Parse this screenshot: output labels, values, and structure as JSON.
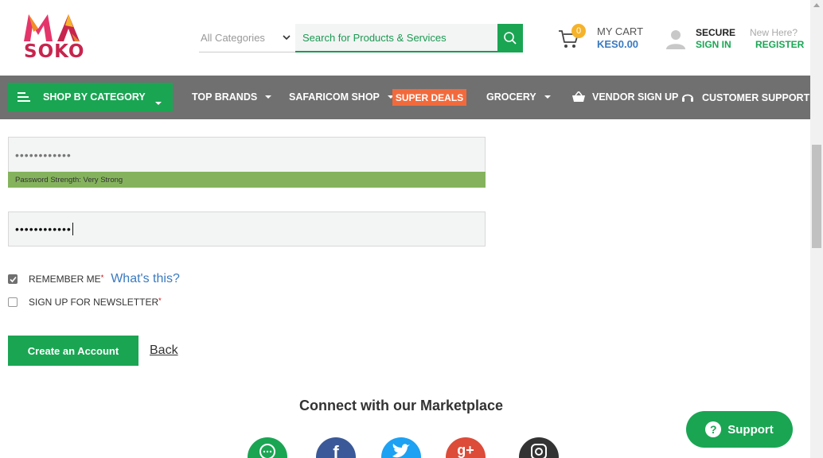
{
  "header": {
    "logo_top": "MA",
    "logo_bottom": "SOKO",
    "category_select": "All Categories",
    "search_placeholder": "Search for Products & Services",
    "cart_count": "0",
    "cart_label": "MY CART",
    "cart_amount": "KES0.00",
    "account_secure": "SECURE",
    "account_signin": "SIGN IN",
    "register_prompt": "New Here?",
    "register_link": "REGISTER"
  },
  "nav": {
    "shop_by_category": "SHOP BY CATEGORY",
    "top_brands": "TOP BRANDS",
    "safaricom_shop": "SAFARICOM SHOP",
    "super_deals": "SUPER DEALS",
    "grocery": "GROCERY",
    "vendor_signup": "VENDOR SIGN UP",
    "customer_support": "CUSTOMER SUPPORT"
  },
  "form": {
    "password_value": "••••••••••••",
    "password_strength": "Password Strength: Very Strong",
    "confirm_value": "••••••••••••",
    "remember_me": "REMEMBER ME",
    "remember_required": "*",
    "remember_checked": true,
    "whats_this": "What's this?",
    "newsletter": "SIGN UP FOR NEWSLETTER",
    "newsletter_required": "*",
    "newsletter_checked": false,
    "create_account": "Create an Account",
    "back": "Back"
  },
  "footer": {
    "connect_title": "Connect with our Marketplace",
    "socials": [
      {
        "name": "whatsapp",
        "color": "#1aa553",
        "glyph": "…"
      },
      {
        "name": "facebook",
        "color": "#3b5998",
        "glyph": "f"
      },
      {
        "name": "twitter",
        "color": "#1da1f2",
        "glyph": "t"
      },
      {
        "name": "google-plus",
        "color": "#dd4b39",
        "glyph": "g+"
      },
      {
        "name": "instagram",
        "color": "#333333",
        "glyph": "◎"
      }
    ]
  },
  "support": {
    "label": "Support",
    "icon": "?"
  },
  "colors": {
    "brand_green": "#1aa553",
    "nav_gray": "#707070",
    "super_deals": "#f26a3c",
    "strength_bar": "#85b35d",
    "link_blue": "#3a7abf"
  }
}
